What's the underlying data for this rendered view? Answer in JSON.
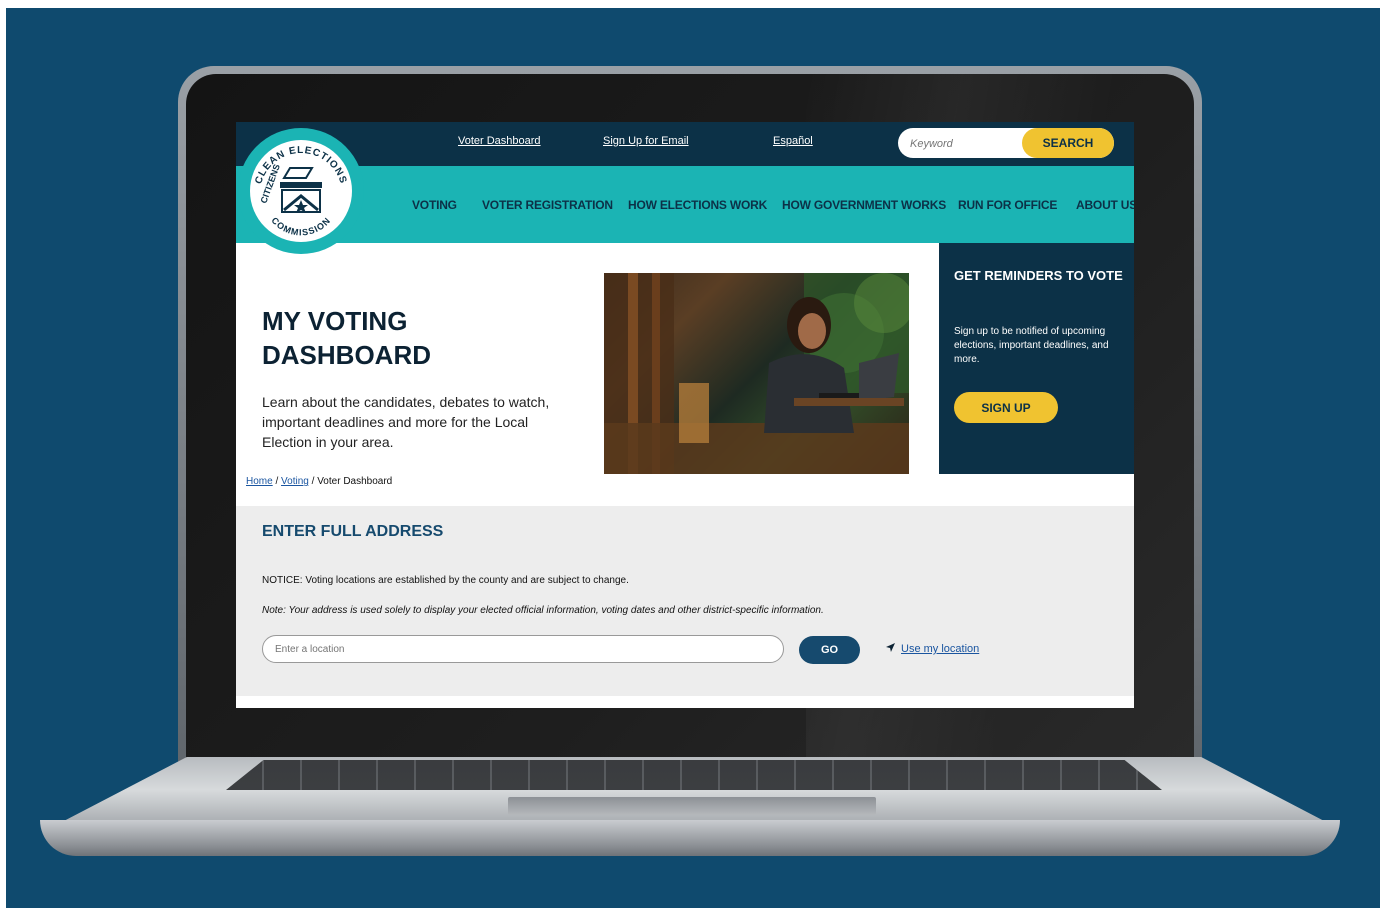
{
  "topbar": {
    "links": [
      "Voter Dashboard",
      "Sign Up for Email",
      "Español"
    ],
    "search_placeholder": "Keyword",
    "search_button": "SEARCH"
  },
  "logo": {
    "arc_top": "CLEAN ELECTIONS",
    "arc_left": "CITIZENS",
    "arc_bottom": "COMMISSION"
  },
  "nav": {
    "items": [
      "VOTING",
      "VOTER REGISTRATION",
      "HOW ELECTIONS WORK",
      "HOW GOVERNMENT WORKS",
      "RUN FOR OFFICE",
      "ABOUT US"
    ]
  },
  "hero": {
    "title": "MY VOTING\nDASHBOARD",
    "description": "Learn about the candidates, debates to watch, important deadlines and more for the Local Election in your area."
  },
  "reminder": {
    "title": "GET REMINDERS TO VOTE",
    "text": "Sign up to be notified of upcoming elections, important deadlines, and more.",
    "button": "SIGN UP"
  },
  "breadcrumb": {
    "home": "Home",
    "sep1": " / ",
    "voting": "Voting",
    "sep2": " / ",
    "current": "Voter Dashboard"
  },
  "address": {
    "title": "ENTER FULL ADDRESS",
    "notice": "NOTICE: Voting locations are established by the county and are subject to change.",
    "note": "Note:  Your address is used solely to display your elected official information, voting dates and other district-specific information.",
    "input_placeholder": "Enter a location",
    "go_button": "GO",
    "use_location": "Use my location"
  },
  "colors": {
    "backdrop": "#0f4a6e",
    "navy": "#0c3147",
    "teal": "#1bb4b4",
    "yellow": "#f0c330",
    "panel_gray": "#ededed"
  },
  "icons": {
    "location_arrow": "navigation-arrow-icon"
  }
}
